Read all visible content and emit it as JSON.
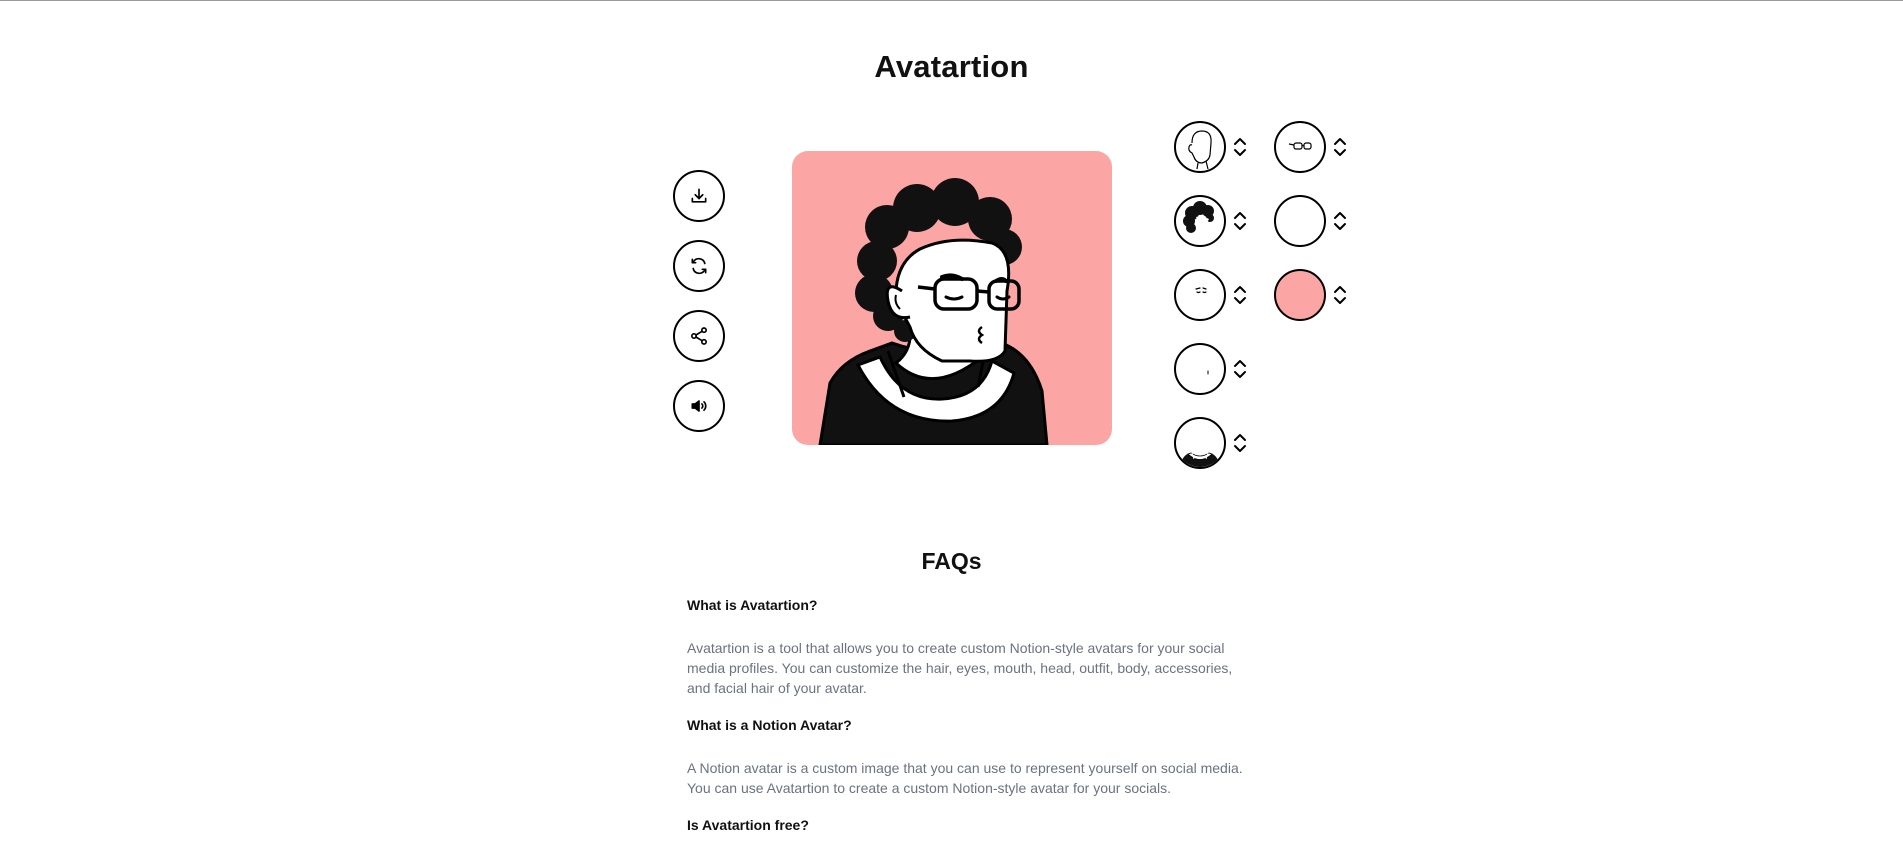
{
  "header": {
    "title": "Avatartion"
  },
  "actions": [
    {
      "name": "download-button",
      "icon": "download-icon"
    },
    {
      "name": "refresh-button",
      "icon": "refresh-icon"
    },
    {
      "name": "share-button",
      "icon": "share-icon"
    },
    {
      "name": "sound-button",
      "icon": "speaker-icon"
    }
  ],
  "avatar": {
    "background_color": "#FCA5A5"
  },
  "pickers": [
    {
      "part": "head",
      "icon": "head-icon"
    },
    {
      "part": "hair",
      "icon": "hair-icon"
    },
    {
      "part": "eyes",
      "icon": "eyes-icon"
    },
    {
      "part": "mouth",
      "icon": "mouth-icon"
    },
    {
      "part": "outfit",
      "icon": "outfit-icon"
    },
    {
      "part": "accessories",
      "icon": "glasses-icon"
    },
    {
      "part": "facial-hair",
      "icon": "empty-icon"
    },
    {
      "part": "background-color",
      "icon": "color-swatch-icon",
      "color": "#FCA5A5"
    }
  ],
  "faq": {
    "title": "FAQs",
    "items": [
      {
        "question": "What is Avatartion?",
        "answer": "Avatartion is a tool that allows you to create custom Notion-style avatars for your social media profiles. You can customize the hair, eyes, mouth, head, outfit, body, accessories, and facial hair of your avatar."
      },
      {
        "question": "What is a Notion Avatar?",
        "answer": "A Notion avatar is a custom image that you can use to represent yourself on social media. You can use Avatartion to create a custom Notion-style avatar for your socials."
      },
      {
        "question": "Is Avatartion free?"
      }
    ]
  }
}
